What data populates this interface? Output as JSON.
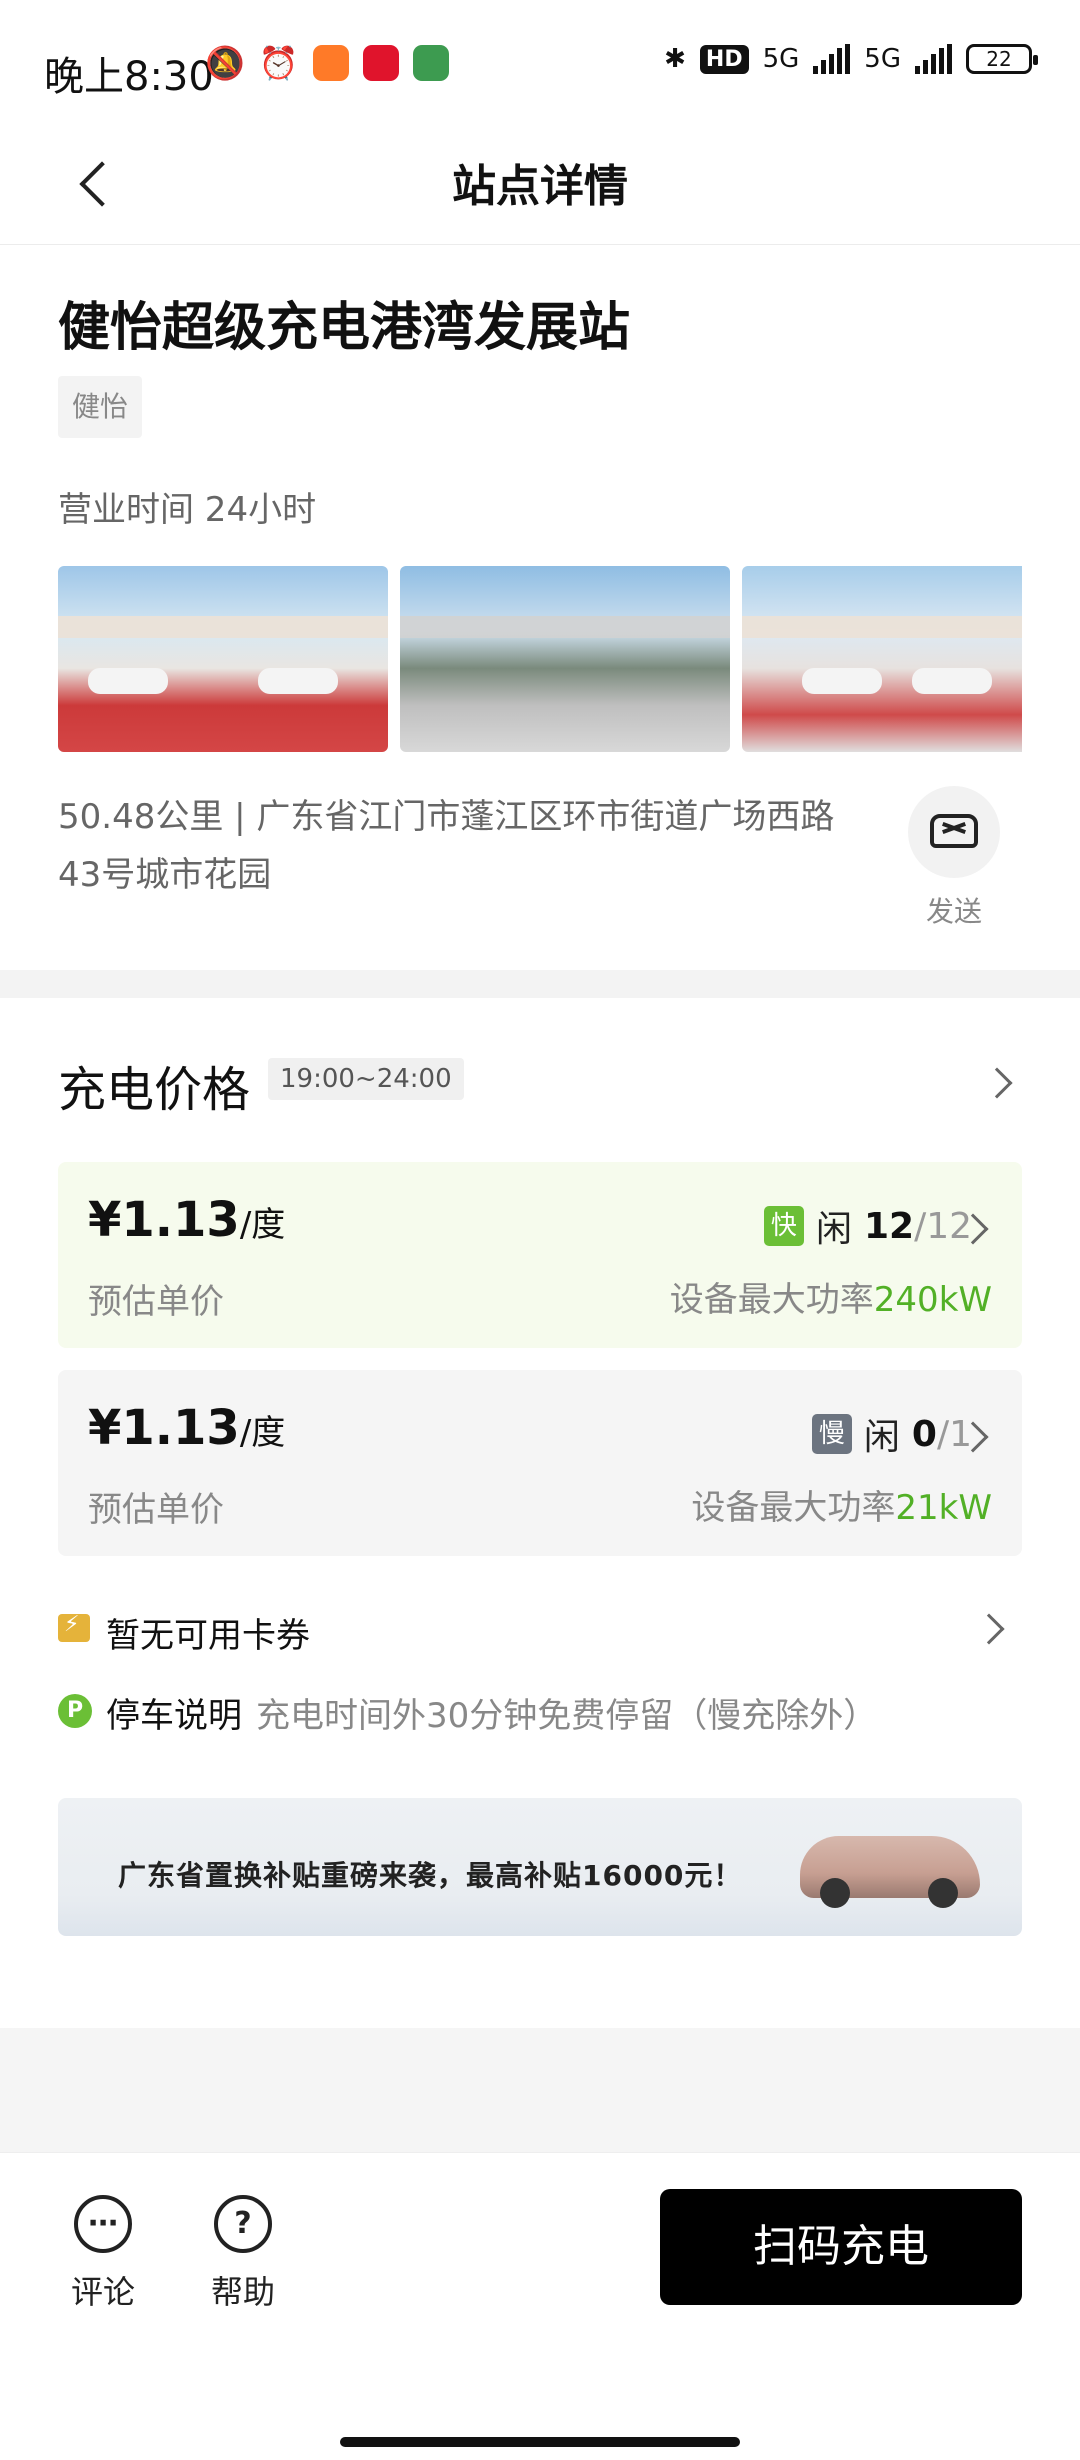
{
  "status_bar": {
    "time": "晚上8:30",
    "network1": "5G",
    "network2": "5G",
    "battery": "22",
    "hd_badge": "HD"
  },
  "header": {
    "title": "站点详情"
  },
  "station": {
    "name": "健怡超级充电港湾发展站",
    "brand": "健怡",
    "hours": "营业时间 24小时",
    "address": "50.48公里 | 广东省江门市蓬江区环市街道广场西路43号城市花园",
    "send_label": "发送"
  },
  "pricing": {
    "title": "充电价格",
    "time_range": "19:00~24:00",
    "cards": [
      {
        "price": "¥1.13",
        "unit": "/度",
        "sub": "预估单价",
        "badge": "快",
        "idle": "闲",
        "available": "12",
        "total": "/12",
        "power_label": "设备最大功率",
        "power": "240kW"
      },
      {
        "price": "¥1.13",
        "unit": "/度",
        "sub": "预估单价",
        "badge": "慢",
        "idle": "闲",
        "available": "0",
        "total": "/1",
        "power_label": "设备最大功率",
        "power": "21kW"
      }
    ]
  },
  "coupon": {
    "text": "暂无可用卡券"
  },
  "parking": {
    "icon": "P",
    "label": "停车说明",
    "desc": "充电时间外30分钟免费停留（慢充除外）"
  },
  "banner": {
    "text": "广东省置换补贴重磅来袭，最高补贴16000元！"
  },
  "bottom_bar": {
    "comment_label": "评论",
    "help_label": "帮助",
    "help_icon": "?",
    "scan_label": "扫码充电"
  },
  "colors": {
    "accent_green": "#52b026",
    "fast_badge": "#6bbf36",
    "slow_badge": "#6c7480",
    "primary_button": "#000000"
  }
}
